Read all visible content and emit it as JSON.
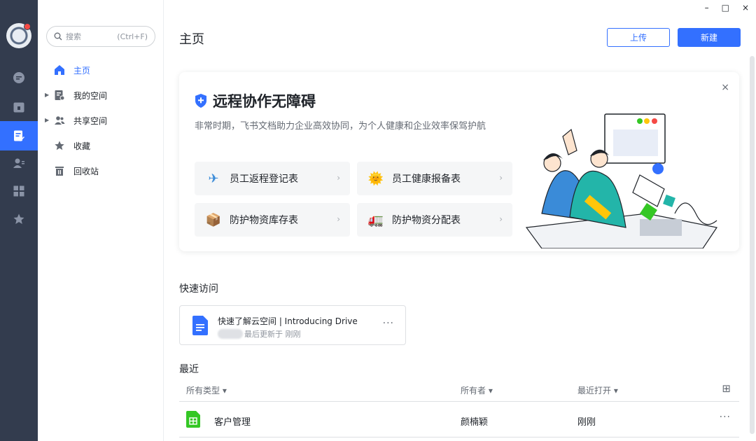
{
  "window_controls": {
    "minimize": "–",
    "maximize": "□",
    "close": "×"
  },
  "search": {
    "placeholder": "搜索",
    "shortcut": "(Ctrl+F)"
  },
  "nav": {
    "home": "主页",
    "my_space": "我的空间",
    "shared_space": "共享空间",
    "favorites": "收藏",
    "trash": "回收站"
  },
  "header": {
    "title": "主页",
    "upload": "上传",
    "new": "新建"
  },
  "banner": {
    "title": "远程协作无障碍",
    "description": "非常时期，飞书文档助力企业高效协同，为个人健康和企业效率保驾护航",
    "close": "×",
    "tiles": [
      {
        "label": "员工返程登记表",
        "icon": "airplane-icon",
        "emoji": "✈"
      },
      {
        "label": "员工健康报备表",
        "icon": "sun-icon",
        "emoji": "🌞"
      },
      {
        "label": "防护物资库存表",
        "icon": "package-icon",
        "emoji": "📦"
      },
      {
        "label": "防护物资分配表",
        "icon": "truck-icon",
        "emoji": "🚛"
      }
    ],
    "chevron": "›"
  },
  "quick_access": {
    "title": "快速访问",
    "item": {
      "title": "快速了解云空间 | Introducing Drive",
      "meta": "最后更新于 刚刚",
      "more": "···"
    }
  },
  "recent": {
    "title": "最近",
    "columns": {
      "type": "所有类型 ▾",
      "owner": "所有者 ▾",
      "opened": "最近打开 ▾"
    },
    "grid_toggle": "⊞",
    "rows": [
      {
        "name": "客户管理",
        "owner": "颜楠颖",
        "opened": "刚刚",
        "more": "···"
      }
    ]
  },
  "colors": {
    "accent": "#3370ff",
    "rail": "#333c4e",
    "sheet_green": "#34c724",
    "doc_blue": "#3370ff"
  }
}
